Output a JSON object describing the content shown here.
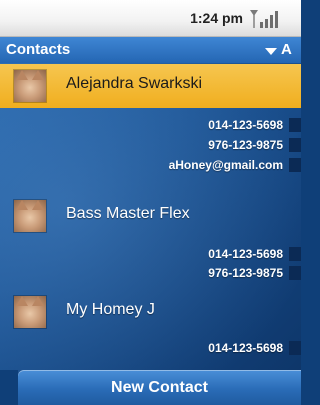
{
  "status_bar": {
    "time": "1:24 pm",
    "signal_icon": "signal-bars-icon"
  },
  "header": {
    "title": "Contacts",
    "sort_label": "A",
    "sort_icon": "triangle-down-icon"
  },
  "contacts": [
    {
      "name": "Alejandra Swarkski",
      "selected": true,
      "details": [
        "014-123-5698",
        "976-123-9875",
        "aHoney@gmail.com"
      ],
      "avatar_icon": "cat-avatar-icon"
    },
    {
      "name": "Bass Master Flex",
      "selected": false,
      "details": [
        "014-123-5698",
        "976-123-9875"
      ],
      "avatar_icon": "cat-avatar-icon"
    },
    {
      "name": "My Homey J",
      "selected": false,
      "details": [
        "014-123-5698"
      ],
      "avatar_icon": "cat-avatar-icon"
    }
  ],
  "footer": {
    "new_contact_label": "New Contact"
  },
  "colors": {
    "header_blue": "#2466b3",
    "selection_orange": "#f0ae1e",
    "background_blue": "#1c5393"
  }
}
